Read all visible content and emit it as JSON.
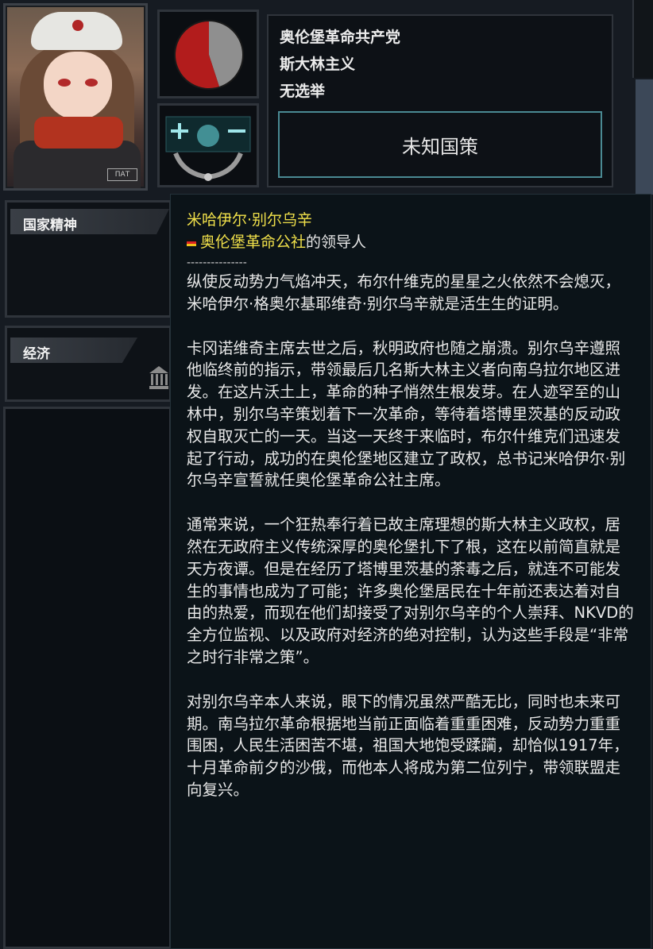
{
  "leader_portrait": {
    "badge_text": "ПАТ"
  },
  "party": {
    "name": "奥伦堡革命共产党",
    "ideology": "斯大林主义",
    "election": "无选举"
  },
  "focus": {
    "label": "未知国策"
  },
  "popularity_pie": {
    "red_fraction": 0.55,
    "red_color": "#b21c1c",
    "grey_color": "#8f8f8f"
  },
  "panels": {
    "national_spirit": "国家精神",
    "economy": "经济"
  },
  "tooltip": {
    "leader_name": "米哈伊尔·别尔乌辛",
    "country": "奥伦堡革命公社",
    "role_suffix": "的领导人",
    "separator": "---------------",
    "paragraphs": [
      "纵使反动势力气焰冲天，布尔什维克的星星之火依然不会熄灭，米哈伊尔·格奥尔基耶维奇·别尔乌辛就是活生生的证明。",
      "卡冈诺维奇主席去世之后，秋明政府也随之崩溃。别尔乌辛遵照他临终前的指示，带领最后几名斯大林主义者向南乌拉尔地区进发。在这片沃土上，革命的种子悄然生根发芽。在人迹罕至的山林中，别尔乌辛策划着下一次革命，等待着塔博里茨基的反动政权自取灭亡的一天。当这一天终于来临时，布尔什维克们迅速发起了行动，成功的在奥伦堡地区建立了政权，总书记米哈伊尔·别尔乌辛宣誓就任奥伦堡革命公社主席。",
      "通常来说，一个狂热奉行着已故主席理想的斯大林主义政权，居然在无政府主义传统深厚的奥伦堡扎下了根，这在以前简直就是天方夜谭。但是在经历了塔博里茨基的荼毒之后，就连不可能发生的事情也成为了可能；许多奥伦堡居民在十年前还表达着对自由的热爱，而现在他们却接受了对别尔乌辛的个人崇拜、NKVD的全方位监视、以及政府对经济的绝对控制，认为这些手段是“非常之时行非常之策”。",
      "对别尔乌辛本人来说，眼下的情况虽然严酷无比，同时也未来可期。南乌拉尔革命根据地当前正面临着重重困难，反动势力重重围困，人民生活困苦不堪，祖国大地饱受蹂躏，却恰似1917年，十月革命前夕的沙俄，而他本人将成为第二位列宁，带领联盟走向复兴。"
    ]
  }
}
